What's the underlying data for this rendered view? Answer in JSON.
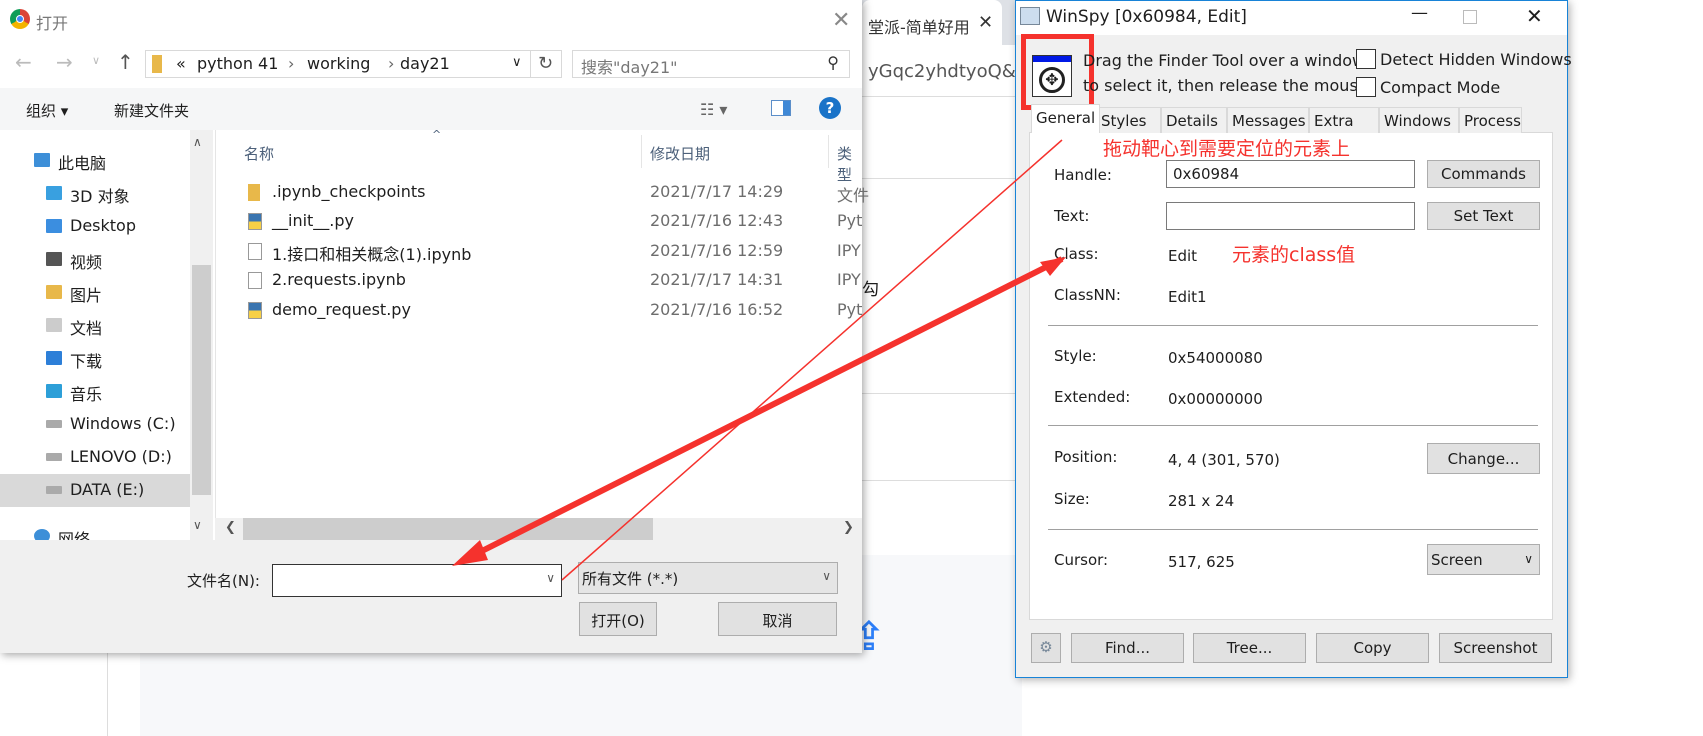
{
  "browser": {
    "tab_title": "堂派-简单好用",
    "address_fragment": "yGqc2yhdtyoQ&",
    "bg_fragment": "勾"
  },
  "dialog": {
    "title": "打开",
    "path": [
      "«",
      "python 41",
      "working",
      "day21"
    ],
    "search_placeholder": "搜索\"day21\"",
    "organize": "组织 ▾",
    "new_folder": "新建文件夹",
    "sidebar": [
      {
        "label": "此电脑"
      },
      {
        "label": "3D 对象"
      },
      {
        "label": "Desktop"
      },
      {
        "label": "视频"
      },
      {
        "label": "图片"
      },
      {
        "label": "文档"
      },
      {
        "label": "下载"
      },
      {
        "label": "音乐"
      },
      {
        "label": "Windows (C:)"
      },
      {
        "label": "LENOVO (D:)"
      },
      {
        "label": "DATA (E:)"
      },
      {
        "label": "网络"
      }
    ],
    "columns": [
      "名称",
      "修改日期",
      "类型"
    ],
    "files": [
      {
        "name": ".ipynb_checkpoints",
        "date": "2021/7/17 14:29",
        "type": "文件",
        "icon": "folder"
      },
      {
        "name": "__init__.py",
        "date": "2021/7/16 12:43",
        "type": "Pyt",
        "icon": "python"
      },
      {
        "name": "1.接口和相关概念(1).ipynb",
        "date": "2021/7/16 12:59",
        "type": "IPY",
        "icon": "file"
      },
      {
        "name": "2.requests.ipynb",
        "date": "2021/7/17 14:31",
        "type": "IPY",
        "icon": "file"
      },
      {
        "name": "demo_request.py",
        "date": "2021/7/16 16:52",
        "type": "Pyt",
        "icon": "python"
      }
    ],
    "filename_label": "文件名(N):",
    "filename_value": "",
    "filter": "所有文件 (*.*)",
    "open": "打开(O)",
    "cancel": "取消"
  },
  "winspy": {
    "title": "WinSpy [0x60984, Edit]",
    "finder_hint_1": "Drag the Finder Tool over a window",
    "finder_hint_2": "to select it, then release the mouse",
    "detect_hidden": "Detect Hidden Windows",
    "compact": "Compact Mode",
    "detect_hidden_checked": false,
    "compact_checked": false,
    "tabs": [
      "General",
      "Styles",
      "Details",
      "Messages",
      "Extra",
      "Windows",
      "Process"
    ],
    "active_tab": "General",
    "handle_label": "Handle:",
    "handle_value": "0x60984",
    "commands": "Commands",
    "text_label": "Text:",
    "text_value": "",
    "set_text": "Set Text",
    "class_label": "Class:",
    "class_value": "Edit",
    "classnn_label": "ClassNN:",
    "classnn_value": "Edit1",
    "style_label": "Style:",
    "style_value": "0x54000080",
    "extended_label": "Extended:",
    "extended_value": "0x00000000",
    "position_label": "Position:",
    "position_value": "4, 4 (301, 570)",
    "change": "Change...",
    "size_label": "Size:",
    "size_value": "281 x 24",
    "cursor_label": "Cursor:",
    "cursor_value": "517, 625",
    "cursor_mode": "Screen",
    "buttons": [
      "Find...",
      "Tree...",
      "Copy",
      "Screenshot"
    ]
  },
  "annotations": {
    "drag_hint": "拖动靶心到需要定位的元素上",
    "class_hint": "元素的class值",
    "color": "#f5322d"
  }
}
